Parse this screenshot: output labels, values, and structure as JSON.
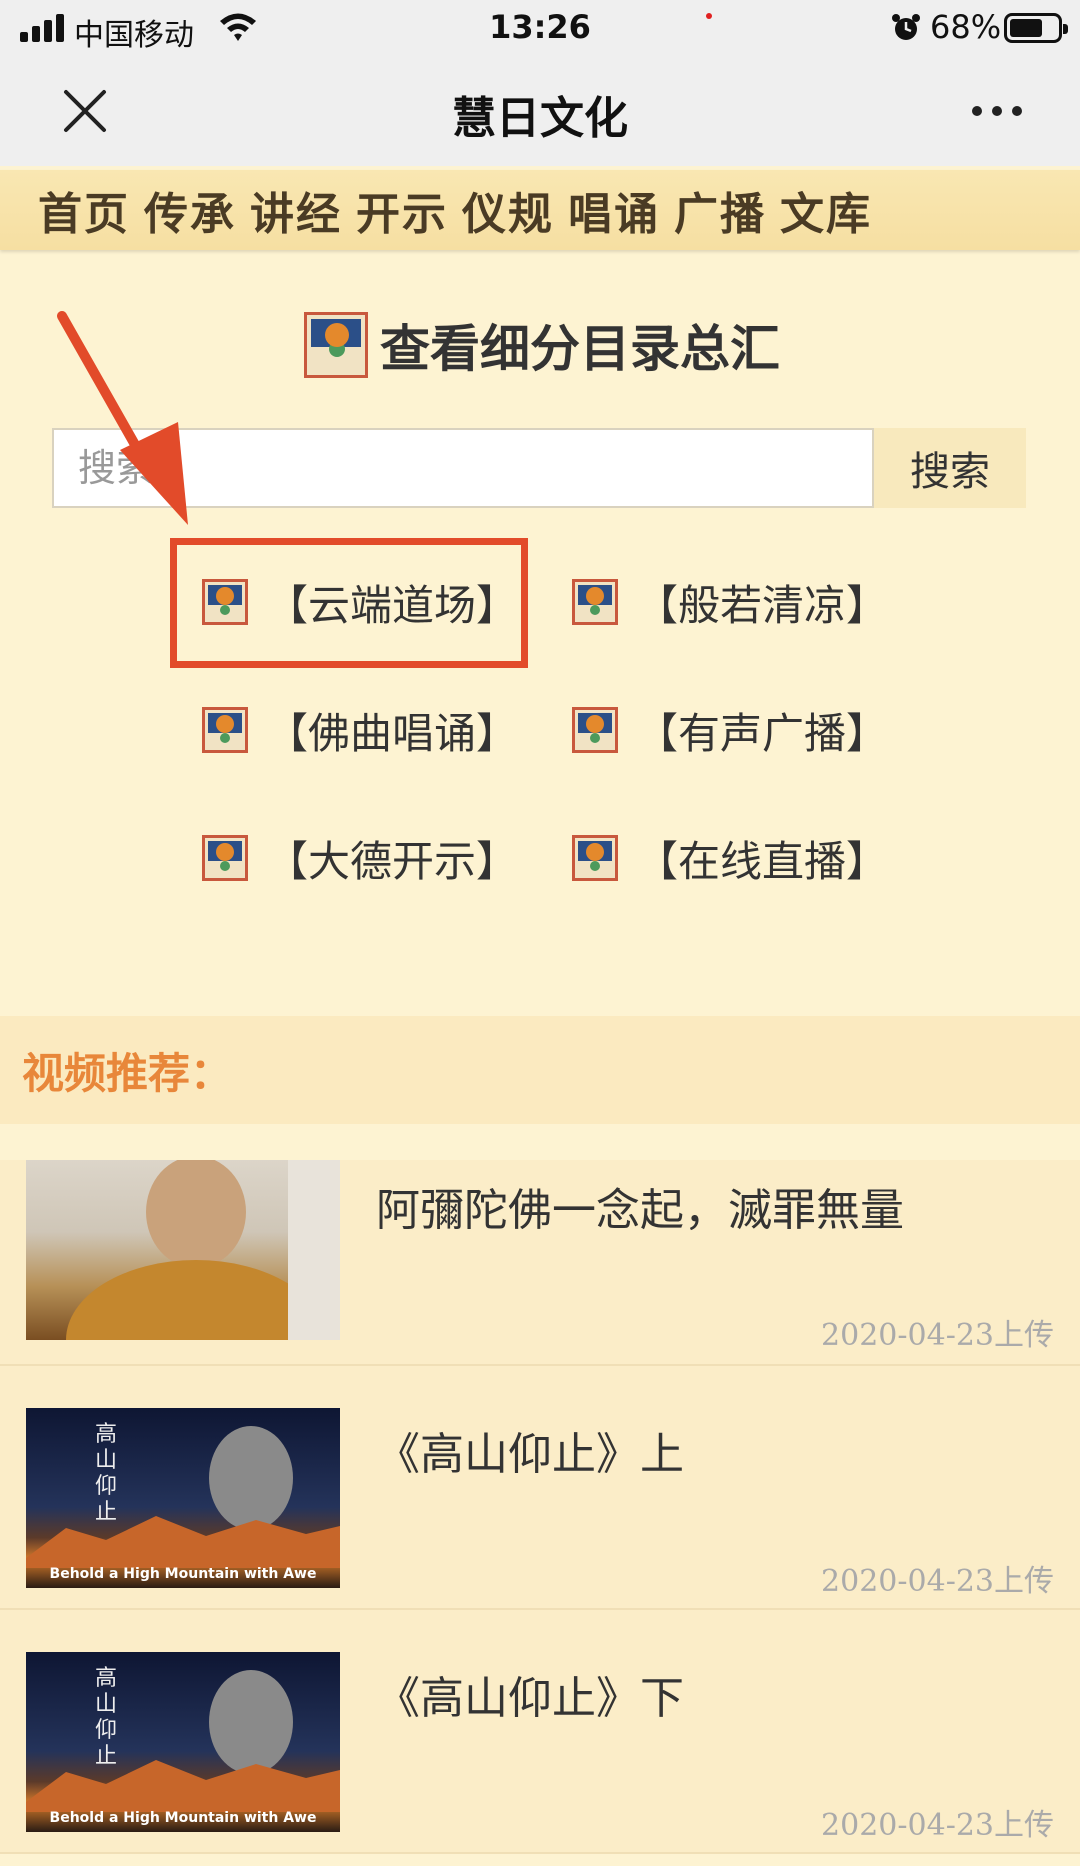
{
  "status_bar": {
    "carrier": "中国移动",
    "time": "13:26",
    "battery_pct": "68%"
  },
  "nav": {
    "title": "慧日文化"
  },
  "menu": [
    "首页",
    "传承",
    "讲经",
    "开示",
    "仪规",
    "唱诵",
    "广播",
    "文库"
  ],
  "directory": {
    "title": "查看细分目录总汇"
  },
  "search": {
    "placeholder": "搜索",
    "button": "搜索"
  },
  "categories": [
    "【云端道场】",
    "【般若清凉】",
    "【佛曲唱诵】",
    "【有声广播】",
    "【大德开示】",
    "【在线直播】"
  ],
  "recommend": {
    "title": "视频推荐："
  },
  "videos": [
    {
      "title": "阿彌陀佛一念起，滅罪無量",
      "date": "2020-04-23上传"
    },
    {
      "title": "《高山仰止》上",
      "date": "2020-04-23上传",
      "thumb_title": "高山仰止",
      "thumb_caption": "Behold a High Mountain with Awe"
    },
    {
      "title": "《高山仰止》下",
      "date": "2020-04-23上传",
      "thumb_title": "高山仰止",
      "thumb_caption": "Behold a High Mountain with Awe"
    }
  ],
  "colors": {
    "background": "#fdf3d2",
    "menu_bar": "#f8e4aa",
    "accent_orange": "#e8873a",
    "annotation_red": "#e24b2a"
  }
}
